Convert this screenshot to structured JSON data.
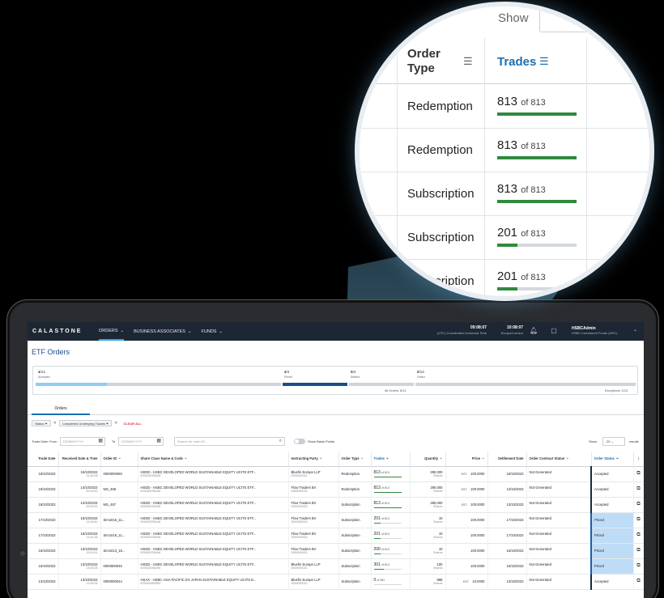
{
  "app": {
    "logo": "CALASTONE",
    "nav": [
      {
        "label": "ORDERS",
        "active": true
      },
      {
        "label": "BUSINESS ASSOCIATES",
        "active": false
      },
      {
        "label": "FUNDS",
        "active": false
      }
    ],
    "clock_utc": {
      "time": "09:08:07",
      "zone": "(UTC) Coordinated Universal Time"
    },
    "clock_local": {
      "time": "10:08:07",
      "zone": "Europe/London"
    },
    "user": {
      "name": "HSBCAdmin",
      "org": "HSBC Investment Funds (HIFL)"
    }
  },
  "page": {
    "title": "ETF Orders",
    "tracker": {
      "stages": [
        {
          "count": "4",
          "total": "/14",
          "label": "Accepted",
          "fill": 0.29
        },
        {
          "count": "4",
          "total": "/4",
          "label": "Priced",
          "fill": 1.0
        },
        {
          "count": "0",
          "total": "/4",
          "label": "Settled",
          "fill": 0
        },
        {
          "count": "0",
          "total": "/13",
          "label": "Failed",
          "fill": 0
        }
      ],
      "all_orders": "All Orders: 8/13",
      "exceptions": "Exceptions: 0/13"
    },
    "tab": "Orders",
    "chips": [
      "Status",
      "Completed Underlying Trades"
    ],
    "clear_all": "CLEAR ALL",
    "filters": {
      "trade_date_from_label": "Trade Date: From",
      "date_placeholder": "DD/MM/YYYY",
      "to_label": "To",
      "search_placeholder": "Search for order ID...",
      "toggle_label": "Show Basis Points",
      "show_label": "Show",
      "show_value": "20",
      "results_label": "results"
    }
  },
  "table": {
    "headers": [
      "Trade Date",
      "Received Date & Time",
      "Order ID",
      "Share Class Name & Code",
      "Instructing Party",
      "Order Type",
      "Trades",
      "Quantity",
      "Price",
      "Settlement Date",
      "Order Contract Status",
      "Order Status"
    ],
    "rows": [
      {
        "trade_date": "18/10/2023",
        "recv_date": "16/10/2023",
        "recv_time": "11:52:08",
        "order_id": "0000000060",
        "share": "HSDD - HSBC DEVELOPED WORLD SUSTAINABLE EQUITY UCITS ETF...",
        "isin": "IE000Z8T8AH8",
        "party": "Bluefin Europe LLP",
        "party_code": "0000000032",
        "type": "Redemption",
        "trades": "813",
        "of": "of 813",
        "trades_fill": 1.0,
        "qty": "290,000",
        "qty_unit": "Shares",
        "est": "EST.",
        "price": "100.0000",
        "settle": "18/10/2023",
        "contract": "Not Generated",
        "contract_sub": "-",
        "status": "Accepted",
        "priced": false
      },
      {
        "trade_date": "18/10/2023",
        "recv_date": "14/10/2023",
        "recv_time": "00:00:00",
        "order_id": "MS_458",
        "share": "HSDD - HSBC DEVELOPED WORLD SUSTAINABLE EQUITY UCITS ETF...",
        "isin": "IE000Z8T8AH8",
        "party": "Flow Traders BV",
        "party_code": "0000000033",
        "type": "Redemption",
        "trades": "813",
        "of": "of 813",
        "trades_fill": 1.0,
        "qty": "290,000",
        "qty_unit": "Shares",
        "est": "EST.",
        "price": "100.0000",
        "settle": "13/10/2023",
        "contract": "Not Generated",
        "contract_sub": "-",
        "status": "Accepted",
        "priced": false
      },
      {
        "trade_date": "18/10/2023",
        "recv_date": "14/10/2023",
        "recv_time": "00:00:00",
        "order_id": "MS_457",
        "share": "HSDD - HSBC DEVELOPED WORLD SUSTAINABLE EQUITY UCITS ETF...",
        "isin": "IE000Z8T8AH8",
        "party": "Flow Traders BV",
        "party_code": "0000000033",
        "type": "Subscription",
        "trades": "813",
        "of": "of 813",
        "trades_fill": 1.0,
        "qty": "280,000",
        "qty_unit": "Shares",
        "est": "EST.",
        "price": "100.0000",
        "settle": "13/10/2023",
        "contract": "Not Generated",
        "contract_sub": "-",
        "status": "Accepted",
        "priced": false
      },
      {
        "trade_date": "17/10/2023",
        "recv_date": "16/10/2023",
        "recv_time": "11:48:40",
        "order_id": "Sim1016_11...",
        "share": "HSDD - HSBC DEVELOPED WORLD SUSTAINABLE EQUITY UCITS ETF...",
        "isin": "IE000Z8T8AH8",
        "party": "Flow Traders BV",
        "party_code": "0000000033",
        "type": "Subscription",
        "trades": "201",
        "of": "of 813",
        "trades_fill": 0.25,
        "qty": "10",
        "qty_unit": "Shares",
        "est": "",
        "price": "100.0000",
        "settle": "17/10/2023",
        "contract": "Not Generated",
        "contract_sub": "-",
        "status": "Priced",
        "priced": true
      },
      {
        "trade_date": "17/10/2023",
        "recv_date": "16/10/2023",
        "recv_time": "11:41:35",
        "order_id": "Sim1016_11...",
        "share": "HSDD - HSBC DEVELOPED WORLD SUSTAINABLE EQUITY UCITS ETF...",
        "isin": "IE000Z8T8AH8",
        "party": "Flow Traders BV",
        "party_code": "0000000033",
        "type": "Subscription",
        "trades": "201",
        "of": "of 813",
        "trades_fill": 0.25,
        "qty": "10",
        "qty_unit": "Shares",
        "est": "",
        "price": "100.0000",
        "settle": "17/10/2023",
        "contract": "Not Generated",
        "contract_sub": "-",
        "status": "Priced",
        "priced": true
      },
      {
        "trade_date": "16/10/2023",
        "recv_date": "13/10/2023",
        "recv_time": "15:19:41",
        "order_id": "Sim1013_15...",
        "share": "HSDD - HSBC DEVELOPED WORLD SUSTAINABLE EQUITY UCITS ETF...",
        "isin": "IE000Z8T8AH8",
        "party": "Flow Traders BV",
        "party_code": "0000000033",
        "type": "Subscription",
        "trades": "200",
        "of": "of 813",
        "trades_fill": 0.25,
        "qty": "10",
        "qty_unit": "Shares",
        "est": "",
        "price": "100.0000",
        "settle": "16/10/2023",
        "contract": "Not Generated",
        "contract_sub": "-",
        "status": "Priced",
        "priced": true
      },
      {
        "trade_date": "16/10/2023",
        "recv_date": "13/10/2023",
        "recv_time": "14:05:28",
        "order_id": "0000000046",
        "share": "HSDD - HSBC DEVELOPED WORLD SUSTAINABLE EQUITY UCITS ETF...",
        "isin": "IE000Z8T8AH8",
        "party": "Bluefin Europe LLP",
        "party_code": "0000000032",
        "type": "Subscription",
        "trades": "301",
        "of": "of 813",
        "trades_fill": 0.37,
        "qty": "100",
        "qty_unit": "Shares",
        "est": "",
        "price": "100.0000",
        "settle": "16/10/2023",
        "contract": "Not Generated",
        "contract_sub": "-",
        "status": "Priced",
        "priced": true
      },
      {
        "trade_date": "13/10/2023",
        "recv_date": "13/10/2023",
        "recv_time": "13:55:05",
        "order_id": "0000000044",
        "share": "HSAX - HSBC ASIA PACIFIC EX JAPAN SUSTAINABLE EQUITY UCITS E...",
        "isin": "IE0002HB9SB1",
        "party": "Bluefin Europe LLP",
        "party_code": "0000000032",
        "type": "Subscription",
        "trades": "0",
        "of": "of 952",
        "trades_fill": 0,
        "qty": "888",
        "qty_unit": "Shares",
        "est": "EST.",
        "price": "10.0000",
        "settle": "13/10/2023",
        "contract": "Not Generated",
        "contract_sub": "-",
        "status": "Accepted",
        "priced": false
      }
    ]
  },
  "lens": {
    "show_label": "Show",
    "order_type_label": "Order Type",
    "trades_label": "Trades",
    "rows": [
      {
        "type": "Redemption",
        "trades": "813",
        "of": "of 813",
        "fill": 1.0
      },
      {
        "type": "Redemption",
        "trades": "813",
        "of": "of 813",
        "fill": 1.0
      },
      {
        "type": "Subscription",
        "trades": "813",
        "of": "of 813",
        "fill": 1.0
      },
      {
        "type": "Subscription",
        "trades": "201",
        "of": "of 813",
        "fill": 0.25
      },
      {
        "type": "Subscription",
        "trades": "201",
        "of": "of 813",
        "fill": 0.25
      }
    ]
  }
}
